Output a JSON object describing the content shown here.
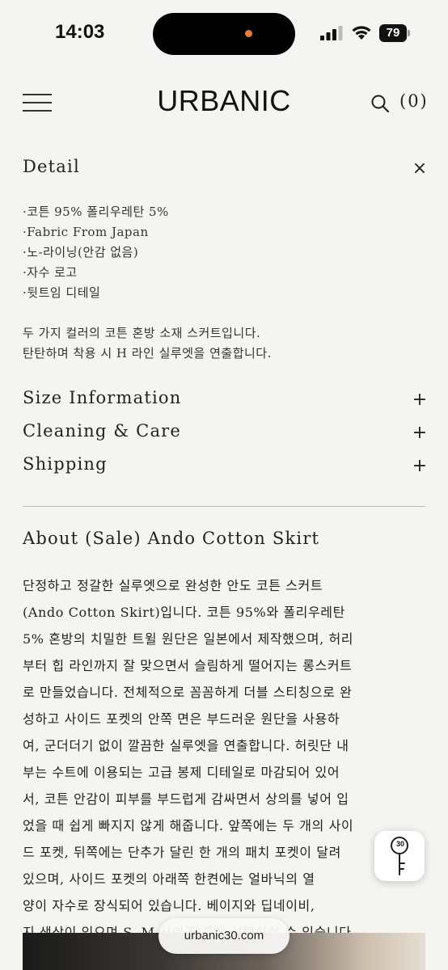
{
  "status_bar": {
    "time": "14:03",
    "battery": "79"
  },
  "header": {
    "logo": "URBANIC",
    "cart": "(0)"
  },
  "detail": {
    "title": "Detail",
    "toggle": "×",
    "bullets": [
      "·코튼 95% 폴리우레탄 5%",
      "·Fabric From Japan",
      "·노-라이닝(안감 없음)",
      "·자수 로고",
      "·뒷트임 디테일"
    ],
    "description": [
      "두 가지 컬러의 코튼 혼방 소재 스커트입니다.",
      "탄탄하며 착용 시 H 라인 실루엣을 연출합니다."
    ]
  },
  "sections": [
    {
      "title": "Size Information",
      "toggle": "+"
    },
    {
      "title": "Cleaning & Care",
      "toggle": "+"
    },
    {
      "title": "Shipping",
      "toggle": "+"
    }
  ],
  "about": {
    "title": "About (Sale) Ando Cotton Skirt",
    "lines": [
      "단정하고 정갈한 실루엣으로 완성한 안도 코튼 스커트",
      "(Ando Cotton Skirt)입니다. 코튼 95%와 폴리우레탄",
      "5% 혼방의 치밀한 트윌 원단은 일본에서 제작했으며, 허리",
      "부터 힙 라인까지 잘 맞으면서 슬림하게 떨어지는 롱스커트",
      "로 만들었습니다. 전체적으로 꼼꼼하게 더블 스티칭으로 완",
      "성하고 사이드 포켓의 안쪽 면은 부드러운 원단을 사용하",
      "여, 군더더기 없이 깔끔한 실루엣을 연출합니다. 허릿단 내",
      "부는 수트에 이용되는 고급 봉제 디테일로 마감되어 있어",
      "서, 코튼 안감이 피부를 부드럽게 감싸면서 상의를 넣어 입",
      "었을 때 쉽게 빠지지 않게 해줍니다. 앞쪽에는 두 개의 사이",
      "드 포켓, 뒤쪽에는 단추가 달린 한 개의 패치 포켓이 달려",
      "있으며, 사이드 포켓의 아래쪽 한켠에는 얼바닉의 열",
      "양이 자수로 장식되어 있습니다. 베이지와 딥네이비,",
      "지 색상이 있으며 S, M 사이즈 중에 선택하실 수 있습니다."
    ]
  },
  "browser": {
    "url": "urbanic30.com"
  },
  "coupon": {
    "number": "30",
    "icon": "key-icon"
  }
}
